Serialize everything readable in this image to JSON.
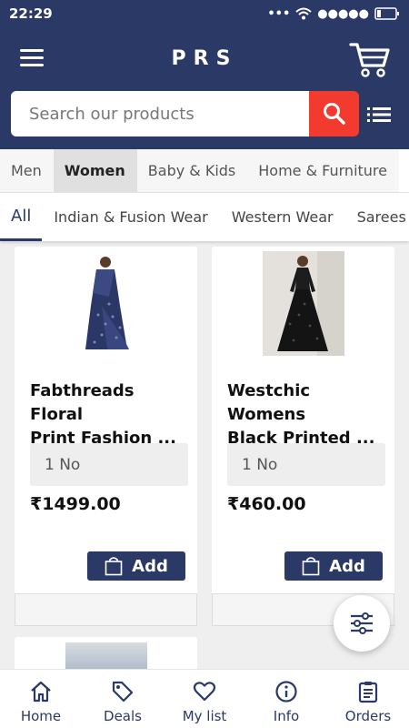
{
  "status_bar": {
    "time": "22:29"
  },
  "header": {
    "title": "PRS"
  },
  "search": {
    "placeholder": "Search our products"
  },
  "category_tabs": [
    {
      "label": "Men",
      "active": false
    },
    {
      "label": "Women",
      "active": true
    },
    {
      "label": "Baby & Kids",
      "active": false
    },
    {
      "label": "Home & Furniture",
      "active": false
    }
  ],
  "sub_tabs": [
    {
      "label": "All",
      "active": true
    },
    {
      "label": "Indian & Fusion Wear",
      "active": false
    },
    {
      "label": "Western Wear",
      "active": false
    },
    {
      "label": "Sarees",
      "active": false
    }
  ],
  "products": [
    {
      "name_line1": "Fabthreads Floral",
      "name_line2": "Print Fashion ...",
      "quantity": "1 No",
      "price": "₹1499.00",
      "add_label": "Add"
    },
    {
      "name_line1": "Westchic Womens",
      "name_line2": "Black Printed ...",
      "quantity": "1 No",
      "price": "₹460.00",
      "add_label": "Add"
    }
  ],
  "bottom_nav": [
    {
      "label": "Home",
      "icon": "home-icon"
    },
    {
      "label": "Deals",
      "icon": "tag-icon"
    },
    {
      "label": "My list",
      "icon": "heart-icon"
    },
    {
      "label": "Info",
      "icon": "info-icon"
    },
    {
      "label": "Orders",
      "icon": "clipboard-icon"
    }
  ],
  "colors": {
    "primary": "#2a3966",
    "accent": "#f33a2e"
  }
}
